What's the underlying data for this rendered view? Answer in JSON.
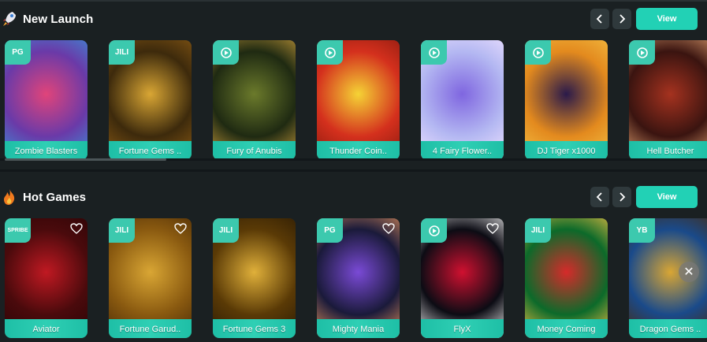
{
  "sections": [
    {
      "title": "New Launch",
      "icon": "rocket-icon",
      "view_label": "View",
      "games": [
        {
          "name": "Zombie Blasters",
          "provider": "PG",
          "heart": false,
          "art": [
            "#6a3aa8",
            "#e0447a",
            "#3a8fd6"
          ]
        },
        {
          "name": "Fortune Gems ..",
          "provider": "JILI",
          "heart": false,
          "art": [
            "#3d2a0c",
            "#d9a634",
            "#8a5a14"
          ]
        },
        {
          "name": "Fury of Anubis",
          "provider": "dragon",
          "heart": false,
          "art": [
            "#1f2a12",
            "#6b7a2b",
            "#c79a3a"
          ]
        },
        {
          "name": "Thunder Coin..",
          "provider": "spin",
          "heart": false,
          "art": [
            "#d4301d",
            "#f5d335",
            "#8a1a0f"
          ]
        },
        {
          "name": "4 Fairy Flower..",
          "provider": "spin",
          "heart": false,
          "art": [
            "#b4b8f2",
            "#7f66e0",
            "#f0e2ff"
          ]
        },
        {
          "name": "DJ Tiger x1000",
          "provider": "spin",
          "heart": false,
          "art": [
            "#e38a1e",
            "#2a1a4a",
            "#f3c044"
          ]
        },
        {
          "name": "Hell Butcher",
          "provider": "dragon",
          "heart": false,
          "art": [
            "#3a1410",
            "#a5321f",
            "#e0a070"
          ]
        }
      ]
    },
    {
      "title": "Hot Games",
      "icon": "fire-icon",
      "view_label": "View",
      "games": [
        {
          "name": "Aviator",
          "provider": "SPRIBE",
          "heart": true,
          "art": [
            "#4a0a0c",
            "#c01922",
            "#2a0406"
          ]
        },
        {
          "name": "Fortune Garud..",
          "provider": "JILI",
          "heart": true,
          "art": [
            "#8a5a10",
            "#d9a634",
            "#4a2a06"
          ]
        },
        {
          "name": "Fortune Gems 3",
          "provider": "JILI",
          "heart": false,
          "art": [
            "#5a3a06",
            "#e0b03a",
            "#2a1a04"
          ]
        },
        {
          "name": "Mighty Mania",
          "provider": "PG",
          "heart": true,
          "art": [
            "#1a1a3a",
            "#7a4ad6",
            "#e0905a"
          ]
        },
        {
          "name": "FlyX",
          "provider": "micro",
          "heart": true,
          "art": [
            "#0c0c14",
            "#d01030",
            "#f0f0f0"
          ]
        },
        {
          "name": "Money Coming",
          "provider": "JILI",
          "heart": false,
          "art": [
            "#0c6a2a",
            "#d62a2a",
            "#f3c044"
          ]
        },
        {
          "name": "Dragon Gems ..",
          "provider": "YB",
          "heart": false,
          "art": [
            "#1a4a8a",
            "#d9a634",
            "#4a2a0a"
          ]
        }
      ]
    }
  ],
  "colors": {
    "accent": "#22d1b5",
    "background": "#1a2022",
    "nav_button": "#2f393c"
  }
}
